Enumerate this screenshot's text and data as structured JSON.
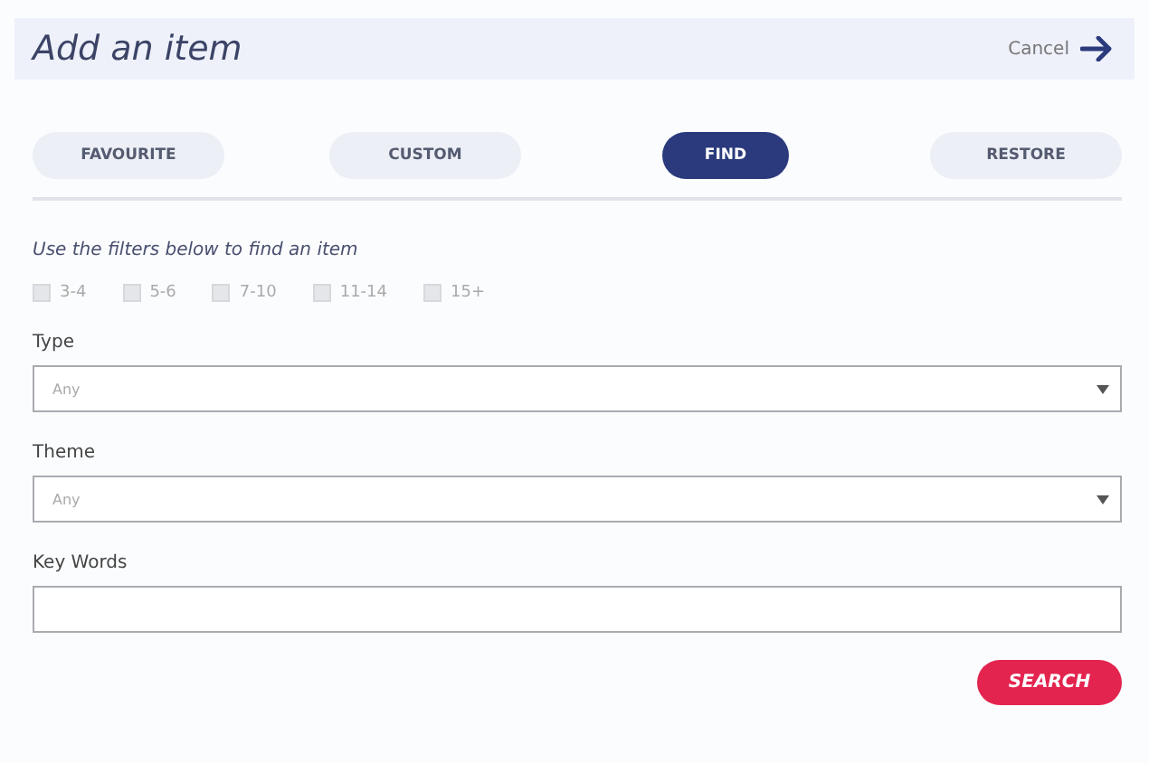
{
  "header": {
    "title": "Add an item",
    "cancel": "Cancel"
  },
  "tabs": [
    {
      "label": "FAVOURITE",
      "selected": false
    },
    {
      "label": "CUSTOM",
      "selected": false
    },
    {
      "label": "FIND",
      "selected": true
    },
    {
      "label": "RESTORE",
      "selected": false
    }
  ],
  "hint": "Use the filters below to find an item",
  "age_filters": [
    {
      "label": "3-4",
      "checked": false
    },
    {
      "label": "5-6",
      "checked": false
    },
    {
      "label": "7-10",
      "checked": false
    },
    {
      "label": "11-14",
      "checked": false
    },
    {
      "label": "15+",
      "checked": false
    }
  ],
  "fields": [
    {
      "kind": "select",
      "label": "Type",
      "value": "Any"
    },
    {
      "kind": "select",
      "label": "Theme",
      "value": "Any"
    },
    {
      "kind": "text",
      "label": "Key Words"
    }
  ],
  "search_button": "SEARCH"
}
